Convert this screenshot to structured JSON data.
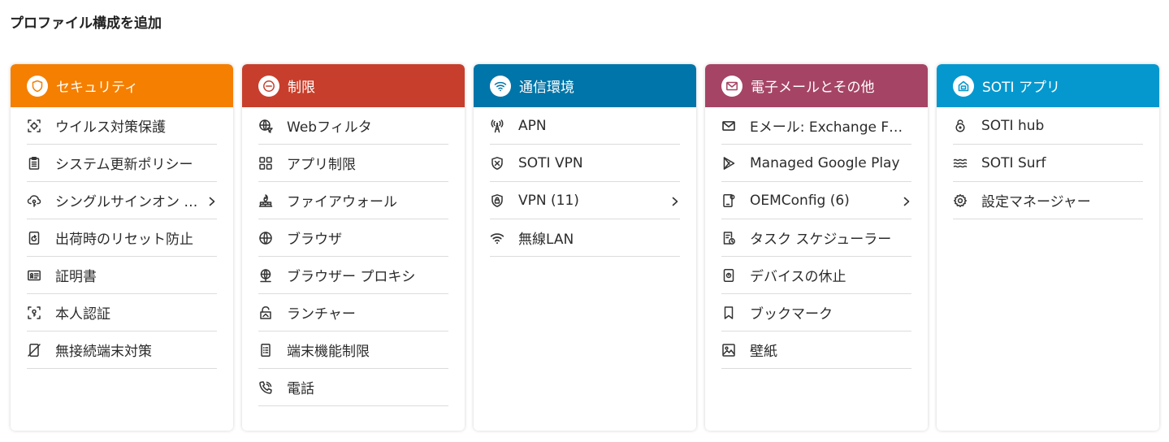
{
  "page": {
    "title": "プロファイル構成を追加"
  },
  "cards": [
    {
      "title": "セキュリティ",
      "color": "#F57F00",
      "icon": "shield-icon",
      "items": [
        {
          "label": "ウイルス対策保護",
          "icon": "virus-scan-icon"
        },
        {
          "label": "システム更新ポリシー",
          "icon": "clipboard-icon"
        },
        {
          "label": "シングルサインオン …",
          "icon": "cloud-key-icon",
          "chevron": true
        },
        {
          "label": "出荷時のリセット防止",
          "icon": "reset-icon"
        },
        {
          "label": "証明書",
          "icon": "certificate-icon"
        },
        {
          "label": "本人認証",
          "icon": "identity-icon"
        },
        {
          "label": "無接続端末対策",
          "icon": "disconnected-device-icon"
        }
      ]
    },
    {
      "title": "制限",
      "color": "#C73F2C",
      "icon": "minus-circle-icon",
      "items": [
        {
          "label": "Webフィルタ",
          "icon": "globe-filter-icon"
        },
        {
          "label": "アプリ制限",
          "icon": "apps-grid-icon"
        },
        {
          "label": "ファイアウォール",
          "icon": "firewall-icon"
        },
        {
          "label": "ブラウザ",
          "icon": "globe-icon"
        },
        {
          "label": "ブラウザー プロキシ",
          "icon": "proxy-globe-icon"
        },
        {
          "label": "ランチャー",
          "icon": "launcher-lock-icon"
        },
        {
          "label": "端末機能制限",
          "icon": "device-feature-icon"
        },
        {
          "label": "電話",
          "icon": "phone-icon"
        }
      ]
    },
    {
      "title": "通信環境",
      "color": "#0075A9",
      "icon": "wifi-icon",
      "items": [
        {
          "label": "APN",
          "icon": "antenna-icon"
        },
        {
          "label": "SOTI VPN",
          "icon": "vpn-shield-icon"
        },
        {
          "label": "VPN (11)",
          "icon": "vpn-icon",
          "chevron": true
        },
        {
          "label": "無線LAN",
          "icon": "wifi-icon"
        }
      ]
    },
    {
      "title": "電子メールとその他",
      "color": "#A64466",
      "icon": "mail-icon",
      "items": [
        {
          "label": "Eメール: Exchange F…",
          "icon": "mail-icon"
        },
        {
          "label": "Managed Google Play",
          "icon": "play-icon"
        },
        {
          "label": "OEMConfig (6)",
          "icon": "device-config-icon",
          "chevron": true
        },
        {
          "label": "タスク スケジューラー",
          "icon": "task-scheduler-icon"
        },
        {
          "label": "デバイスの休止",
          "icon": "device-sleep-icon"
        },
        {
          "label": "ブックマーク",
          "icon": "bookmark-icon"
        },
        {
          "label": "壁紙",
          "icon": "wallpaper-icon"
        }
      ]
    },
    {
      "title": "SOTI アプリ",
      "color": "#0598CF",
      "icon": "home-app-icon",
      "items": [
        {
          "label": "SOTI hub",
          "icon": "soti-hub-icon"
        },
        {
          "label": "SOTI Surf",
          "icon": "soti-surf-icon"
        },
        {
          "label": "設定マネージャー",
          "icon": "gear-icon"
        }
      ]
    }
  ]
}
